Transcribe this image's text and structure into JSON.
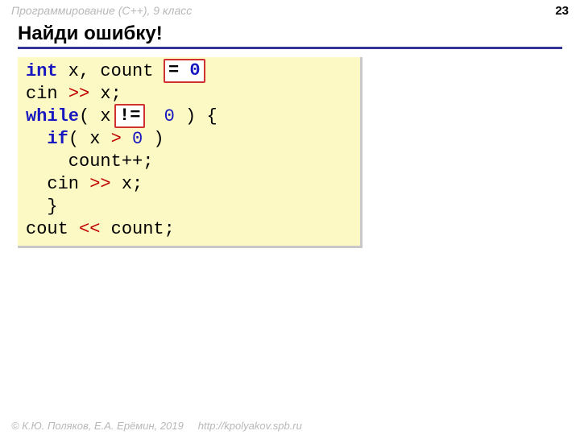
{
  "header": {
    "course": "Программирование (C++), 9 класс",
    "page_number": "23"
  },
  "title": "Найди ошибку!",
  "code": {
    "l1_kw": "int",
    "l1_rest": " x, count",
    "l1_tail": "    ;",
    "l2_a": "cin ",
    "l2_op": ">>",
    "l2_b": " x;",
    "l3_kw": "while",
    "l3_a": "( x ",
    "l3_op": "!=",
    "l3_b": "  ",
    "l3_num": "0",
    "l3_c": " ) {",
    "l4_pre": "  ",
    "l4_kw": "if",
    "l4_a": "( x ",
    "l4_op": ">",
    "l4_b": " ",
    "l4_num": "0",
    "l4_c": " )",
    "l5": "    count++;",
    "l6_a": "  cin ",
    "l6_op": ">>",
    "l6_b": " x;",
    "l7": "  }",
    "l8_a": "cout ",
    "l8_op": "<<",
    "l8_b": " count;"
  },
  "fixes": {
    "fix1_eq": "= ",
    "fix1_zero": "0",
    "fix2": "!="
  },
  "footer": {
    "copyright": "© К.Ю. Поляков, Е.А. Ерёмин, 2019",
    "url": "http://kpolyakov.spb.ru"
  }
}
